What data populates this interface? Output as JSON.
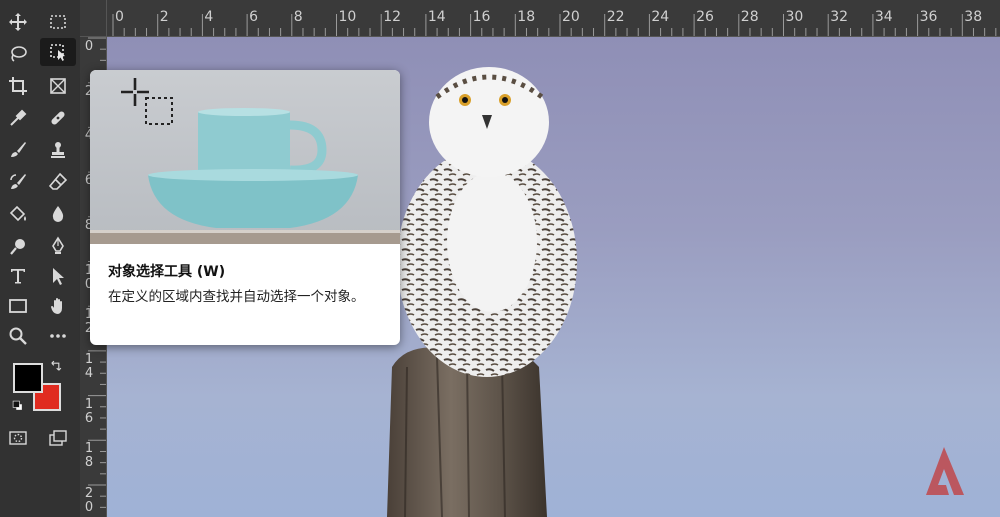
{
  "ruler": {
    "top_labels": [
      "0",
      "2",
      "4",
      "6",
      "8",
      "10",
      "12",
      "14",
      "16",
      "18",
      "20",
      "22",
      "24",
      "26",
      "28",
      "30",
      "32",
      "34",
      "36",
      "38"
    ],
    "left_labels": [
      "0",
      "2",
      "4",
      "6",
      "8",
      "1\n0",
      "1\n2",
      "1\n4",
      "1\n6",
      "1\n8",
      "2\n0"
    ]
  },
  "tooltip": {
    "title": "对象选择工具 (W)",
    "description": "在定义的区域内查找并自动选择一个对象。"
  },
  "colors": {
    "foreground": "#000000",
    "background": "#e02b20",
    "accent_watermark": "#c0474a"
  },
  "tools": [
    {
      "name": "move-tool-icon"
    },
    {
      "name": "marquee-tool-icon"
    },
    {
      "name": "lasso-tool-icon"
    },
    {
      "name": "object-selection-tool-icon"
    },
    {
      "name": "crop-tool-icon"
    },
    {
      "name": "frame-tool-icon"
    },
    {
      "name": "eyedropper-tool-icon"
    },
    {
      "name": "healing-brush-icon"
    },
    {
      "name": "brush-tool-icon"
    },
    {
      "name": "clone-stamp-icon"
    },
    {
      "name": "history-brush-icon"
    },
    {
      "name": "eraser-tool-icon"
    },
    {
      "name": "paint-bucket-icon"
    },
    {
      "name": "blur-tool-icon"
    },
    {
      "name": "dodge-tool-icon"
    },
    {
      "name": "pen-tool-icon"
    },
    {
      "name": "type-tool-icon"
    },
    {
      "name": "path-selection-icon"
    },
    {
      "name": "rectangle-tool-icon"
    },
    {
      "name": "hand-tool-icon"
    },
    {
      "name": "zoom-tool-icon"
    },
    {
      "name": "more-tools-icon"
    }
  ]
}
